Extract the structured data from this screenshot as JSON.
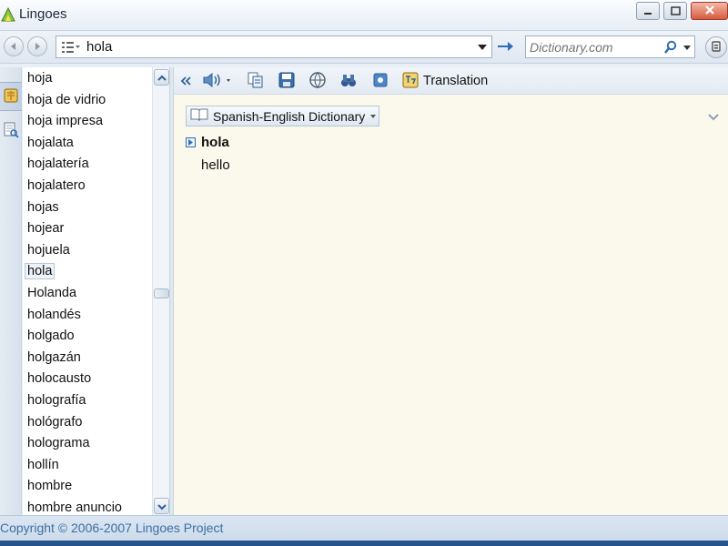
{
  "window": {
    "title": "Lingoes"
  },
  "toolbar": {
    "search_value": "hola",
    "web_search_placeholder": "Dictionary.com"
  },
  "wordlist": {
    "items": [
      "hoja",
      "hoja de vidrio",
      "hoja impresa",
      "hojalata",
      "hojalatería",
      "hojalatero",
      "hojas",
      "hojear",
      "hojuela",
      "hola",
      "Holanda",
      "holandés",
      "holgado",
      "holgazán",
      "holocausto",
      "holografía",
      "hológrafo",
      "holograma",
      "hollín",
      "hombre",
      "hombre anuncio"
    ],
    "selected": "hola"
  },
  "main": {
    "toolbar": {
      "translation_label": "Translation"
    },
    "dictionary": {
      "name": "Spanish-English Dictionary"
    },
    "entry": {
      "headword": "hola",
      "definition": "hello"
    }
  },
  "status": {
    "text": "Copyright © 2006-2007 Lingoes Project"
  },
  "colors": {
    "content_bg": "#fbf9ec",
    "accent_blue": "#2f6fb0",
    "status_text": "#3d6fa3"
  },
  "icons": [
    "lingoes-logo-icon",
    "minimize-icon",
    "maximize-icon",
    "close-icon",
    "back-arrow-icon",
    "forward-arrow-icon",
    "list-icon",
    "go-arrow-icon",
    "magnifier-icon",
    "menu-icon",
    "dictionary-book-icon",
    "search-doc-icon",
    "collapse-left-icon",
    "speaker-icon",
    "copy-icon",
    "save-icon",
    "globe-icon",
    "binoculars-icon",
    "pin-icon",
    "translation-icon",
    "book-icon",
    "chevron-down-icon"
  ]
}
